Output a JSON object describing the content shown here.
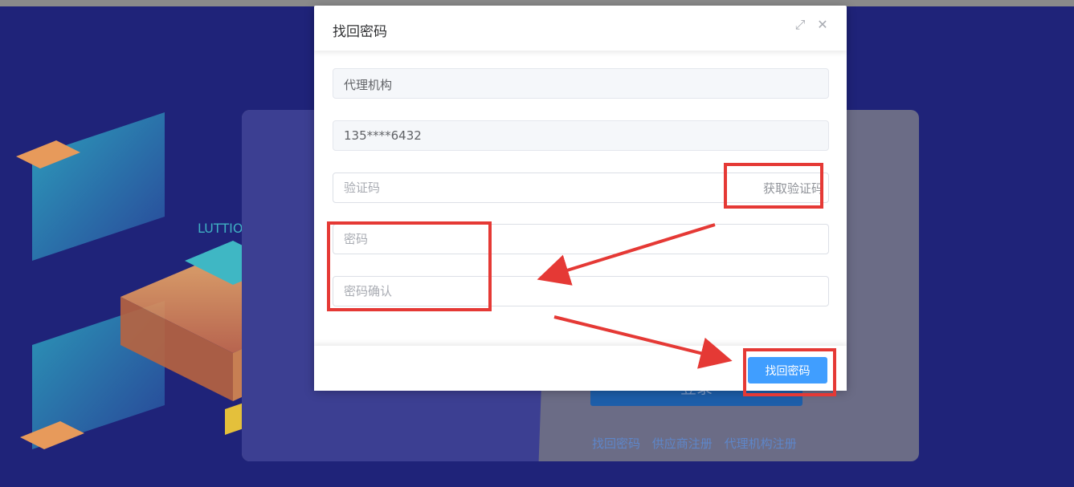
{
  "background": {
    "brand_text": "LUTTIOB"
  },
  "login": {
    "login_button_label": "登录",
    "links": [
      "找回密码",
      "供应商注册",
      "代理机构注册"
    ]
  },
  "dialog": {
    "title": "找回密码",
    "fields": {
      "role": "代理机构",
      "phone": "135****6432",
      "code_placeholder": "验证码",
      "get_code_label": "获取验证码",
      "password_placeholder": "密码",
      "password_confirm_placeholder": "密码确认"
    },
    "submit_label": "找回密码"
  },
  "colors": {
    "primary": "#409eff",
    "annotation": "#e53935",
    "background": "#1f2379"
  }
}
